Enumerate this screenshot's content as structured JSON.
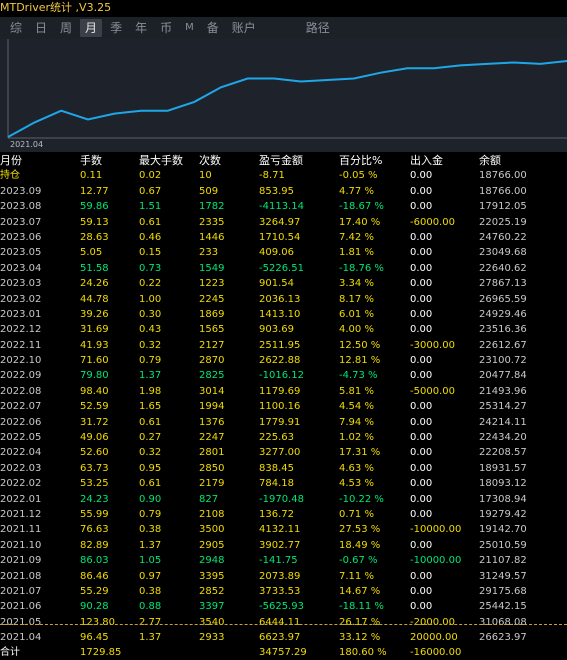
{
  "title": "MTDriver统计 ,V3.25",
  "tabs": [
    {
      "label": "综",
      "active": false
    },
    {
      "label": "日",
      "active": false
    },
    {
      "label": "周",
      "active": false
    },
    {
      "label": "月",
      "active": true
    },
    {
      "label": "季",
      "active": false
    },
    {
      "label": "年",
      "active": false
    },
    {
      "label": "币",
      "active": false
    },
    {
      "label": "M",
      "active": false
    },
    {
      "label": "备",
      "active": false
    },
    {
      "label": "账户",
      "active": false
    },
    {
      "label": "路径",
      "active": false
    }
  ],
  "chart": {
    "line_color": "#1ea7e8",
    "start_label": "2021.04"
  },
  "chart_data": {
    "type": "line",
    "series": [
      {
        "values": [
          0.5,
          1.0,
          1.4,
          1.1,
          1.3,
          1.4,
          1.4,
          1.7,
          2.2,
          2.5,
          2.5,
          2.4,
          2.45,
          2.5,
          2.7,
          2.85,
          2.85,
          2.95,
          3.0,
          3.05,
          3.0,
          3.1
        ]
      }
    ]
  },
  "table": {
    "headers": [
      "月份",
      "手数",
      "最大手数",
      "次数",
      "盈亏金额",
      "百分比%",
      "出入金",
      "余额"
    ],
    "rows": [
      {
        "c": [
          "持仓",
          "0.11",
          "0.02",
          "10",
          "-8.71",
          "-0.05 %",
          "0.00",
          "18766.00"
        ],
        "color": "yel"
      },
      {
        "c": [
          "2023.09",
          "12.77",
          "0.67",
          "509",
          "853.95",
          "4.77 %",
          "0.00",
          "18766.00"
        ],
        "color": "yel"
      },
      {
        "c": [
          "2023.08",
          "59.86",
          "1.51",
          "1782",
          "-4113.14",
          "-18.67 %",
          "0.00",
          "17912.05"
        ],
        "color": "grn"
      },
      {
        "c": [
          "2023.07",
          "59.13",
          "0.61",
          "2335",
          "3264.97",
          "17.40 %",
          "-6000.00",
          "22025.19"
        ],
        "color": "yel"
      },
      {
        "c": [
          "2023.06",
          "28.63",
          "0.46",
          "1446",
          "1710.54",
          "7.42 %",
          "0.00",
          "24760.22"
        ],
        "color": "yel"
      },
      {
        "c": [
          "2023.05",
          "5.05",
          "0.15",
          "233",
          "409.06",
          "1.81 %",
          "0.00",
          "23049.68"
        ],
        "color": "yel"
      },
      {
        "c": [
          "2023.04",
          "51.58",
          "0.73",
          "1549",
          "-5226.51",
          "-18.76 %",
          "0.00",
          "22640.62"
        ],
        "color": "grn"
      },
      {
        "c": [
          "2023.03",
          "24.26",
          "0.22",
          "1223",
          "901.54",
          "3.34 %",
          "0.00",
          "27867.13"
        ],
        "color": "yel"
      },
      {
        "c": [
          "2023.02",
          "44.78",
          "1.00",
          "2245",
          "2036.13",
          "8.17 %",
          "0.00",
          "26965.59"
        ],
        "color": "yel"
      },
      {
        "c": [
          "2023.01",
          "39.26",
          "0.30",
          "1869",
          "1413.10",
          "6.01 %",
          "0.00",
          "24929.46"
        ],
        "color": "yel"
      },
      {
        "c": [
          "2022.12",
          "31.69",
          "0.43",
          "1565",
          "903.69",
          "4.00 %",
          "0.00",
          "23516.36"
        ],
        "color": "yel"
      },
      {
        "c": [
          "2022.11",
          "41.93",
          "0.32",
          "2127",
          "2511.95",
          "12.50 %",
          "-3000.00",
          "22612.67"
        ],
        "color": "yel"
      },
      {
        "c": [
          "2022.10",
          "71.60",
          "0.79",
          "2870",
          "2622.88",
          "12.81 %",
          "0.00",
          "23100.72"
        ],
        "color": "yel"
      },
      {
        "c": [
          "2022.09",
          "79.80",
          "1.37",
          "2825",
          "-1016.12",
          "-4.73 %",
          "0.00",
          "20477.84"
        ],
        "color": "grn"
      },
      {
        "c": [
          "2022.08",
          "98.40",
          "1.98",
          "3014",
          "1179.69",
          "5.81 %",
          "-5000.00",
          "21493.96"
        ],
        "color": "yel"
      },
      {
        "c": [
          "2022.07",
          "52.59",
          "1.65",
          "1994",
          "1100.16",
          "4.54 %",
          "0.00",
          "25314.27"
        ],
        "color": "yel"
      },
      {
        "c": [
          "2022.06",
          "31.72",
          "0.61",
          "1376",
          "1779.91",
          "7.94 %",
          "0.00",
          "24214.11"
        ],
        "color": "yel"
      },
      {
        "c": [
          "2022.05",
          "49.06",
          "0.27",
          "2247",
          "225.63",
          "1.02 %",
          "0.00",
          "22434.20"
        ],
        "color": "yel"
      },
      {
        "c": [
          "2022.04",
          "52.60",
          "0.32",
          "2801",
          "3277.00",
          "17.31 %",
          "0.00",
          "22208.57"
        ],
        "color": "yel"
      },
      {
        "c": [
          "2022.03",
          "63.73",
          "0.95",
          "2850",
          "838.45",
          "4.63 %",
          "0.00",
          "18931.57"
        ],
        "color": "yel"
      },
      {
        "c": [
          "2022.02",
          "53.25",
          "0.61",
          "2179",
          "784.18",
          "4.53 %",
          "0.00",
          "18093.12"
        ],
        "color": "yel"
      },
      {
        "c": [
          "2022.01",
          "24.23",
          "0.90",
          "827",
          "-1970.48",
          "-10.22 %",
          "0.00",
          "17308.94"
        ],
        "color": "grn"
      },
      {
        "c": [
          "2021.12",
          "55.99",
          "0.79",
          "2108",
          "136.72",
          "0.71 %",
          "0.00",
          "19279.42"
        ],
        "color": "yel"
      },
      {
        "c": [
          "2021.11",
          "76.63",
          "0.38",
          "3500",
          "4132.11",
          "27.53 %",
          "-10000.00",
          "19142.70"
        ],
        "color": "yel"
      },
      {
        "c": [
          "2021.10",
          "82.89",
          "1.37",
          "2905",
          "3902.77",
          "18.49 %",
          "0.00",
          "25010.59"
        ],
        "color": "yel"
      },
      {
        "c": [
          "2021.09",
          "86.03",
          "1.05",
          "2948",
          "-141.75",
          "-0.67 %",
          "-10000.00",
          "21107.82"
        ],
        "color": "grn"
      },
      {
        "c": [
          "2021.08",
          "86.46",
          "0.97",
          "3395",
          "2073.89",
          "7.11 %",
          "0.00",
          "31249.57"
        ],
        "color": "yel"
      },
      {
        "c": [
          "2021.07",
          "55.29",
          "0.38",
          "2852",
          "3733.53",
          "14.67 %",
          "0.00",
          "29175.68"
        ],
        "color": "yel"
      },
      {
        "c": [
          "2021.06",
          "90.28",
          "0.88",
          "3397",
          "-5625.93",
          "-18.11 %",
          "0.00",
          "25442.15"
        ],
        "color": "grn"
      },
      {
        "c": [
          "2021.05",
          "123.80",
          "2.77",
          "3540",
          "6444.11",
          "26.17 %",
          "-2000.00",
          "31068.08"
        ],
        "color": "yel"
      },
      {
        "c": [
          "2021.04",
          "96.45",
          "1.37",
          "2933",
          "6623.97",
          "33.12 %",
          "20000.00",
          "26623.97"
        ],
        "color": "yel"
      }
    ],
    "total": {
      "c": [
        "合计",
        "1729.85",
        "",
        "",
        "34757.29",
        "180.60 %",
        "-16000.00",
        ""
      ]
    }
  }
}
